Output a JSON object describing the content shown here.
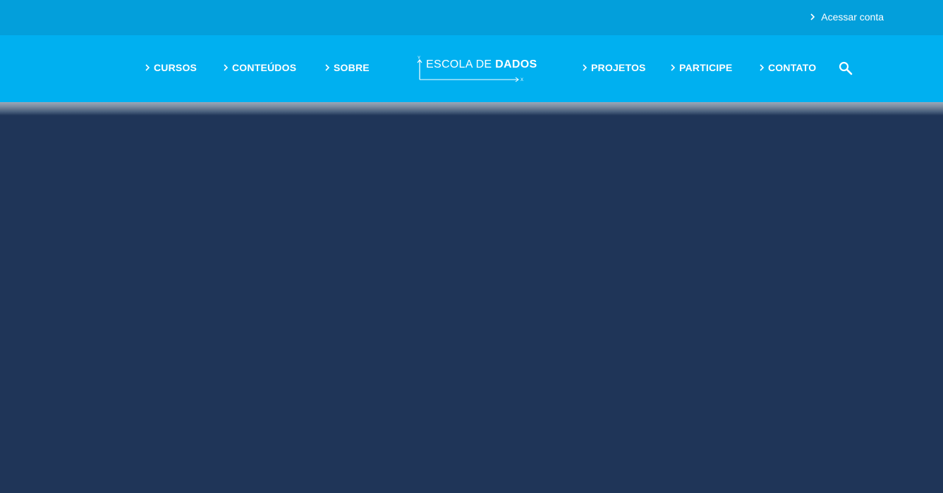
{
  "topbar": {
    "account_label": "Acessar conta"
  },
  "nav": {
    "left_items": [
      {
        "label": "CURSOS"
      },
      {
        "label": "CONTEÚDOS"
      },
      {
        "label": "SOBRE"
      }
    ],
    "right_items": [
      {
        "label": "PROJETOS"
      },
      {
        "label": "PARTICIPE"
      },
      {
        "label": "CONTATO"
      }
    ],
    "search_icon": "search-icon"
  },
  "logo": {
    "text_light": "ESCOLA DE ",
    "text_bold": "DADOS"
  },
  "colors": {
    "topbar": "#039fdb",
    "navbar": "#00b0f0",
    "main": "#1f3558",
    "text": "#ffffff"
  }
}
